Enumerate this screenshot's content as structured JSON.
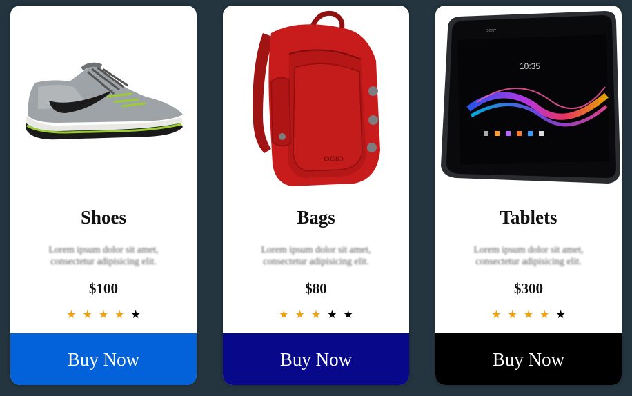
{
  "products": [
    {
      "name": "Shoes",
      "description": "Lorem ipsum dolor sit amet, consectetur adipisicing elit.",
      "price": "$100",
      "rating": 5,
      "rating_filled": 4,
      "button_label": "Buy Now",
      "button_color": "#0362d9",
      "image_icon": "sneaker-image"
    },
    {
      "name": "Bags",
      "description": "Lorem ipsum dolor sit amet, consectetur adipisicing elit.",
      "price": "$80",
      "rating": 5,
      "rating_filled": 3,
      "button_label": "Buy Now",
      "button_color": "#07088a",
      "image_icon": "backpack-image"
    },
    {
      "name": "Tablets",
      "description": "Lorem ipsum dolor sit amet, consectetur adipisicing elit.",
      "price": "$300",
      "rating": 5,
      "rating_filled": 4,
      "button_label": "Buy Now",
      "button_color": "#000000",
      "image_icon": "tablet-image"
    }
  ],
  "colors": {
    "page_background": "#243540",
    "star_filled": "#f2a20c",
    "star_empty": "#000000"
  }
}
